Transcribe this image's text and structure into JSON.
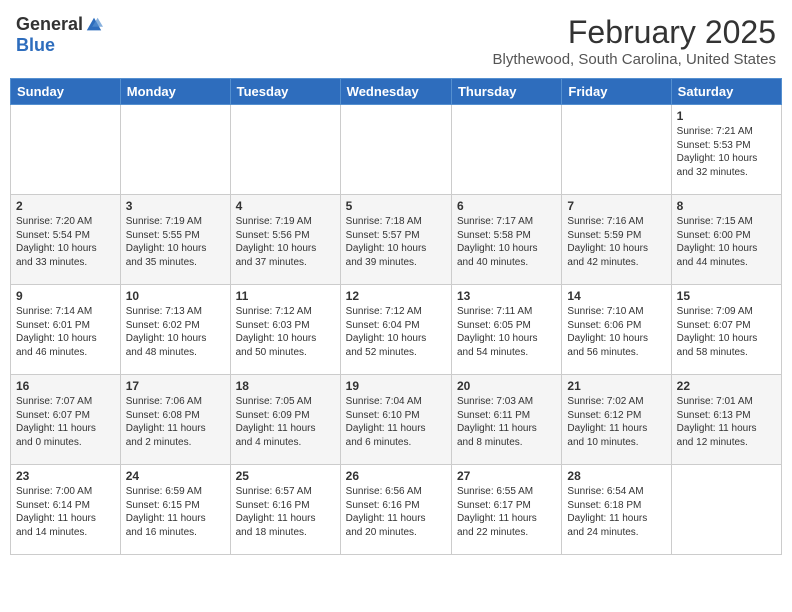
{
  "header": {
    "logo_general": "General",
    "logo_blue": "Blue",
    "month_title": "February 2025",
    "location": "Blythewood, South Carolina, United States"
  },
  "weekdays": [
    "Sunday",
    "Monday",
    "Tuesday",
    "Wednesday",
    "Thursday",
    "Friday",
    "Saturday"
  ],
  "weeks": [
    [
      {
        "day": "",
        "info": ""
      },
      {
        "day": "",
        "info": ""
      },
      {
        "day": "",
        "info": ""
      },
      {
        "day": "",
        "info": ""
      },
      {
        "day": "",
        "info": ""
      },
      {
        "day": "",
        "info": ""
      },
      {
        "day": "1",
        "info": "Sunrise: 7:21 AM\nSunset: 5:53 PM\nDaylight: 10 hours\nand 32 minutes."
      }
    ],
    [
      {
        "day": "2",
        "info": "Sunrise: 7:20 AM\nSunset: 5:54 PM\nDaylight: 10 hours\nand 33 minutes."
      },
      {
        "day": "3",
        "info": "Sunrise: 7:19 AM\nSunset: 5:55 PM\nDaylight: 10 hours\nand 35 minutes."
      },
      {
        "day": "4",
        "info": "Sunrise: 7:19 AM\nSunset: 5:56 PM\nDaylight: 10 hours\nand 37 minutes."
      },
      {
        "day": "5",
        "info": "Sunrise: 7:18 AM\nSunset: 5:57 PM\nDaylight: 10 hours\nand 39 minutes."
      },
      {
        "day": "6",
        "info": "Sunrise: 7:17 AM\nSunset: 5:58 PM\nDaylight: 10 hours\nand 40 minutes."
      },
      {
        "day": "7",
        "info": "Sunrise: 7:16 AM\nSunset: 5:59 PM\nDaylight: 10 hours\nand 42 minutes."
      },
      {
        "day": "8",
        "info": "Sunrise: 7:15 AM\nSunset: 6:00 PM\nDaylight: 10 hours\nand 44 minutes."
      }
    ],
    [
      {
        "day": "9",
        "info": "Sunrise: 7:14 AM\nSunset: 6:01 PM\nDaylight: 10 hours\nand 46 minutes."
      },
      {
        "day": "10",
        "info": "Sunrise: 7:13 AM\nSunset: 6:02 PM\nDaylight: 10 hours\nand 48 minutes."
      },
      {
        "day": "11",
        "info": "Sunrise: 7:12 AM\nSunset: 6:03 PM\nDaylight: 10 hours\nand 50 minutes."
      },
      {
        "day": "12",
        "info": "Sunrise: 7:12 AM\nSunset: 6:04 PM\nDaylight: 10 hours\nand 52 minutes."
      },
      {
        "day": "13",
        "info": "Sunrise: 7:11 AM\nSunset: 6:05 PM\nDaylight: 10 hours\nand 54 minutes."
      },
      {
        "day": "14",
        "info": "Sunrise: 7:10 AM\nSunset: 6:06 PM\nDaylight: 10 hours\nand 56 minutes."
      },
      {
        "day": "15",
        "info": "Sunrise: 7:09 AM\nSunset: 6:07 PM\nDaylight: 10 hours\nand 58 minutes."
      }
    ],
    [
      {
        "day": "16",
        "info": "Sunrise: 7:07 AM\nSunset: 6:07 PM\nDaylight: 11 hours\nand 0 minutes."
      },
      {
        "day": "17",
        "info": "Sunrise: 7:06 AM\nSunset: 6:08 PM\nDaylight: 11 hours\nand 2 minutes."
      },
      {
        "day": "18",
        "info": "Sunrise: 7:05 AM\nSunset: 6:09 PM\nDaylight: 11 hours\nand 4 minutes."
      },
      {
        "day": "19",
        "info": "Sunrise: 7:04 AM\nSunset: 6:10 PM\nDaylight: 11 hours\nand 6 minutes."
      },
      {
        "day": "20",
        "info": "Sunrise: 7:03 AM\nSunset: 6:11 PM\nDaylight: 11 hours\nand 8 minutes."
      },
      {
        "day": "21",
        "info": "Sunrise: 7:02 AM\nSunset: 6:12 PM\nDaylight: 11 hours\nand 10 minutes."
      },
      {
        "day": "22",
        "info": "Sunrise: 7:01 AM\nSunset: 6:13 PM\nDaylight: 11 hours\nand 12 minutes."
      }
    ],
    [
      {
        "day": "23",
        "info": "Sunrise: 7:00 AM\nSunset: 6:14 PM\nDaylight: 11 hours\nand 14 minutes."
      },
      {
        "day": "24",
        "info": "Sunrise: 6:59 AM\nSunset: 6:15 PM\nDaylight: 11 hours\nand 16 minutes."
      },
      {
        "day": "25",
        "info": "Sunrise: 6:57 AM\nSunset: 6:16 PM\nDaylight: 11 hours\nand 18 minutes."
      },
      {
        "day": "26",
        "info": "Sunrise: 6:56 AM\nSunset: 6:16 PM\nDaylight: 11 hours\nand 20 minutes."
      },
      {
        "day": "27",
        "info": "Sunrise: 6:55 AM\nSunset: 6:17 PM\nDaylight: 11 hours\nand 22 minutes."
      },
      {
        "day": "28",
        "info": "Sunrise: 6:54 AM\nSunset: 6:18 PM\nDaylight: 11 hours\nand 24 minutes."
      },
      {
        "day": "",
        "info": ""
      }
    ]
  ]
}
